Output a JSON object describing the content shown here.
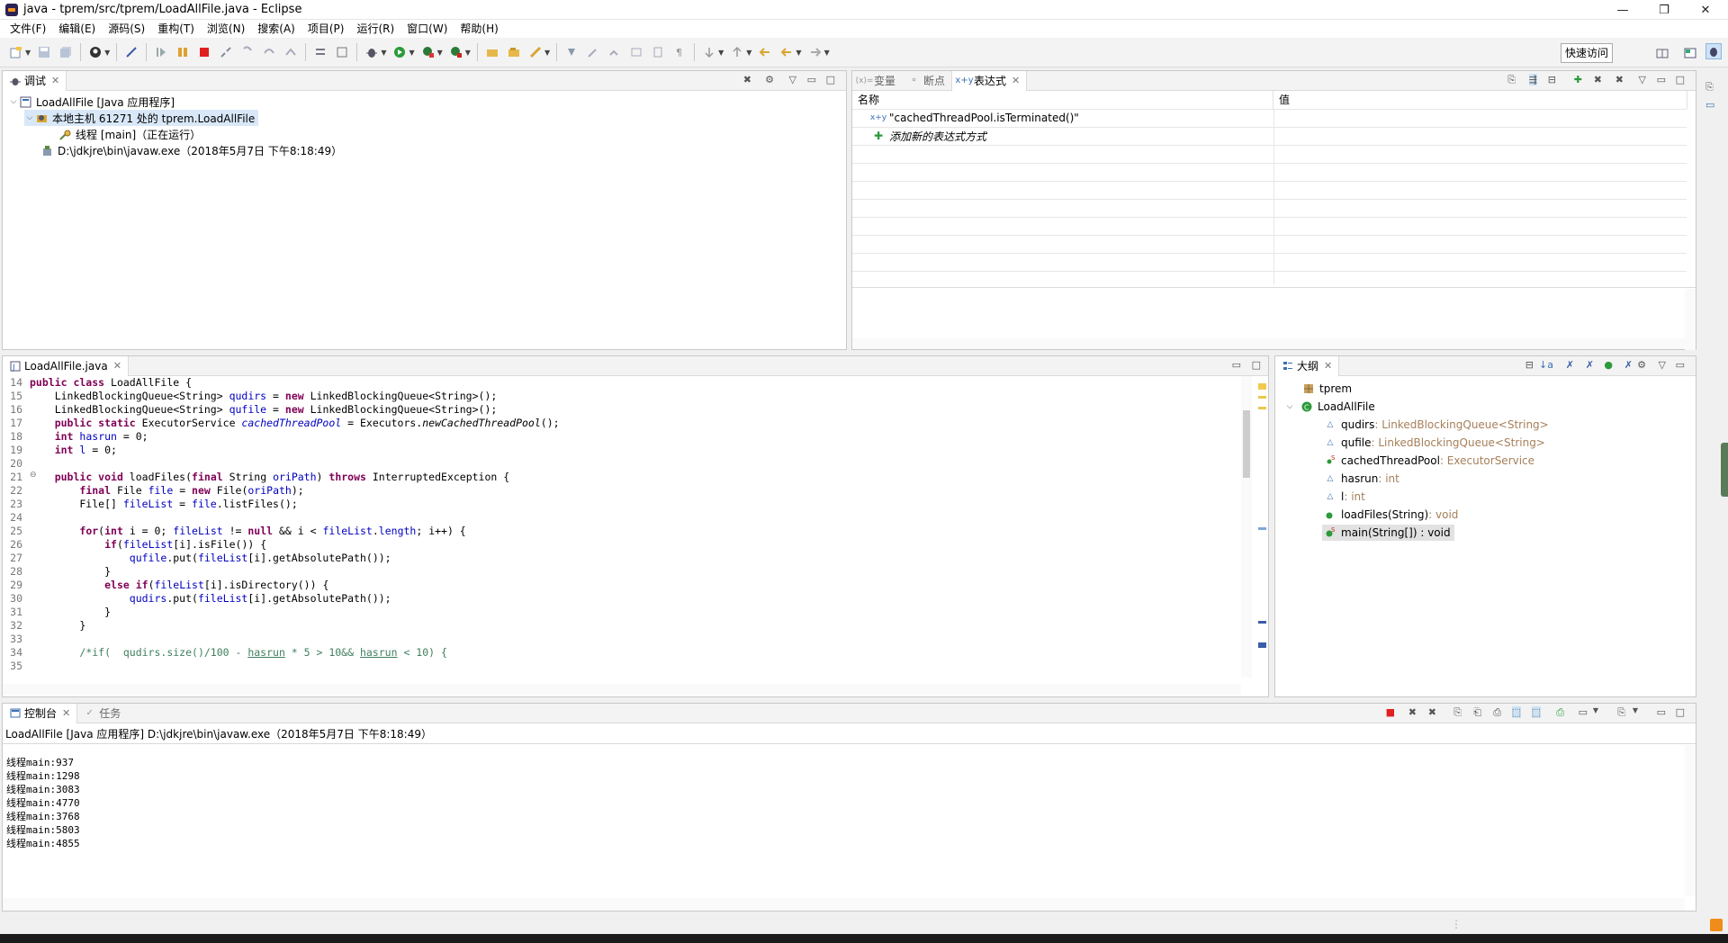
{
  "window": {
    "title": "java - tprem/src/tprem/LoadAllFile.java - Eclipse",
    "minimize": "—",
    "maximize": "❐",
    "close": "✕"
  },
  "menu": [
    "文件(F)",
    "编辑(E)",
    "源码(S)",
    "重构(T)",
    "浏览(N)",
    "搜索(A)",
    "项目(P)",
    "运行(R)",
    "窗口(W)",
    "帮助(H)"
  ],
  "toolbar": {
    "quick_access": "快速访问"
  },
  "debug_view": {
    "tab": "调试",
    "items": [
      {
        "label": "LoadAllFile [Java 应用程序]"
      },
      {
        "label": "本地主机 61271 处的 tprem.LoadAllFile"
      },
      {
        "label": "线程 [main]（正在运行）"
      },
      {
        "label": "D:\\jdkjre\\bin\\javaw.exe（2018年5月7日 下午8:18:49）"
      }
    ]
  },
  "expressions_view": {
    "tabs": [
      "变量",
      "断点",
      "表达式"
    ],
    "col_name": "名称",
    "col_value": "值",
    "rows": [
      {
        "name": "\"cachedThreadPool.isTerminated()\"",
        "value": ""
      },
      {
        "name": "添加新的表达式方式",
        "value": ""
      }
    ]
  },
  "editor": {
    "tab": "LoadAllFile.java",
    "lines": [
      {
        "n": "14"
      },
      {
        "n": "15"
      },
      {
        "n": "16"
      },
      {
        "n": "17"
      },
      {
        "n": "18"
      },
      {
        "n": "19"
      },
      {
        "n": "20"
      },
      {
        "n": "21"
      },
      {
        "n": "22"
      },
      {
        "n": "23"
      },
      {
        "n": "24"
      },
      {
        "n": "25"
      },
      {
        "n": "26"
      },
      {
        "n": "27"
      },
      {
        "n": "28"
      },
      {
        "n": "29"
      },
      {
        "n": "30"
      },
      {
        "n": "31"
      },
      {
        "n": "32"
      },
      {
        "n": "33"
      },
      {
        "n": "34"
      },
      {
        "n": "35"
      }
    ]
  },
  "outline": {
    "tab": "大纲",
    "items": [
      {
        "name": "tprem",
        "type": ""
      },
      {
        "name": "LoadAllFile",
        "type": ""
      },
      {
        "name": "qudirs",
        "type": " : LinkedBlockingQueue<String>"
      },
      {
        "name": "qufile",
        "type": " : LinkedBlockingQueue<String>"
      },
      {
        "name": "cachedThreadPool",
        "type": " : ExecutorService"
      },
      {
        "name": "hasrun",
        "type": " : int"
      },
      {
        "name": "l",
        "type": " : int"
      },
      {
        "name": "loadFiles(String)",
        "type": " : void"
      },
      {
        "name": "main(String[]) : void",
        "type": ""
      }
    ]
  },
  "console": {
    "tabs": [
      "控制台",
      "任务"
    ],
    "header": "LoadAllFile [Java 应用程序] D:\\jdkjre\\bin\\javaw.exe（2018年5月7日 下午8:18:49）",
    "lines": [
      "线程main:937",
      "线程main:1298",
      "线程main:3083",
      "线程main:4770",
      "线程main:3768",
      "线程main:5803",
      "线程main:4855"
    ]
  },
  "colors": {
    "keyword": "#7f0055",
    "field": "#0000c0",
    "comment": "#3f7f5f",
    "type_gray": "#a67f59"
  }
}
